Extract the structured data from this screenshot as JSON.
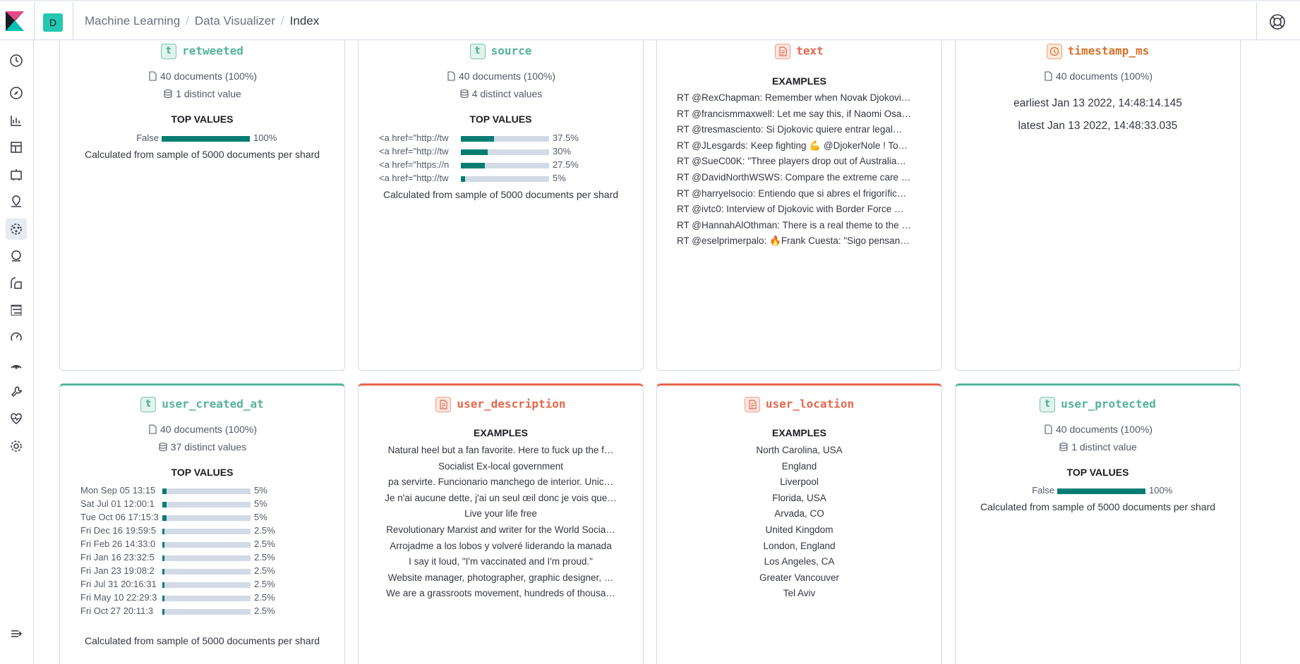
{
  "header": {
    "space_initial": "D",
    "breadcrumbs": [
      "Machine Learning",
      "Data Visualizer",
      "Index"
    ]
  },
  "sidebar": {
    "icons": [
      "clock-icon",
      "compass-icon",
      "chart-icon",
      "dashboard-icon",
      "canvas-icon",
      "maps-icon",
      "machine-learning-icon",
      "graph-icon",
      "observability-icon",
      "logs-icon",
      "apm-icon",
      "uptime-icon",
      "dev-tools-icon",
      "stack-monitoring-icon",
      "management-icon",
      "collapse-icon"
    ]
  },
  "colors": {
    "keyword": "#54b399",
    "text": "#e7664c",
    "date": "#d6712c",
    "bar_fill": "#017d73",
    "bar_track": "#d3dae6"
  },
  "cards": {
    "retweeted": {
      "name": "retweeted",
      "type_icon": "t",
      "documents": "40 documents (100%)",
      "distinct": "1 distinct value",
      "top_values_title": "TOP VALUES",
      "top_values": [
        {
          "label": "False",
          "pct_text": "100%",
          "pct": 100
        }
      ],
      "footer": "Calculated from sample of 5000 documents per shard"
    },
    "source": {
      "name": "source",
      "type_icon": "t",
      "documents": "40 documents (100%)",
      "distinct": "4 distinct values",
      "top_values_title": "TOP VALUES",
      "top_values": [
        {
          "label": "<a href=\"http://tw",
          "pct_text": "37.5%",
          "pct": 37.5
        },
        {
          "label": "<a href=\"http://tw",
          "pct_text": "30%",
          "pct": 30
        },
        {
          "label": "<a href=\"https://n",
          "pct_text": "27.5%",
          "pct": 27.5
        },
        {
          "label": "<a href=\"http://tw",
          "pct_text": "5%",
          "pct": 5
        }
      ],
      "footer": "Calculated from sample of 5000 documents per shard"
    },
    "text": {
      "name": "text",
      "examples_title": "EXAMPLES",
      "examples": [
        "RT @RexChapman: Remember when Novak Djokovi…",
        "RT @francismmaxwell: Let me say this, if Naomi Osa…",
        "RT @tresmasciento: Si Djokovic quiere entrar legal…",
        "RT @JLesgards: Keep fighting 💪 @DjokerNole ! To…",
        "RT @SueC00K: \"Three players drop out of Australia…",
        "RT @DavidNorthWSWS: Compare the extreme care …",
        "RT @harryelsocio: Entiendo que si abres el frigorífic…",
        "RT @ivtc0: Interview of Djokovic with Border Force …",
        "RT @HannahAlOthman: There is a real theme to the …",
        "RT @eselprimerpalo: 🔥Frank Cuesta: \"Sigo pensan…"
      ]
    },
    "timestamp_ms": {
      "name": "timestamp_ms",
      "documents": "40 documents (100%)",
      "earliest": "earliest Jan 13 2022, 14:48:14.145",
      "latest": "latest Jan 13 2022, 14:48:33.035"
    },
    "user_created_at": {
      "name": "user_created_at",
      "type_icon": "t",
      "documents": "40 documents (100%)",
      "distinct": "37 distinct values",
      "top_values_title": "TOP VALUES",
      "top_values": [
        {
          "label": "Mon Sep 05 13:15",
          "pct_text": "5%",
          "pct": 5
        },
        {
          "label": "Sat Jul 01 12:00:1",
          "pct_text": "5%",
          "pct": 5
        },
        {
          "label": "Tue Oct 06 17:15:3",
          "pct_text": "5%",
          "pct": 5
        },
        {
          "label": "Fri Dec 16 19:59:5",
          "pct_text": "2.5%",
          "pct": 2.5
        },
        {
          "label": "Fri Feb 26 14:33:0",
          "pct_text": "2.5%",
          "pct": 2.5
        },
        {
          "label": "Fri Jan 16 23:32:5",
          "pct_text": "2.5%",
          "pct": 2.5
        },
        {
          "label": "Fri Jan 23 19:08:2",
          "pct_text": "2.5%",
          "pct": 2.5
        },
        {
          "label": "Fri Jul 31 20:16:31",
          "pct_text": "2.5%",
          "pct": 2.5
        },
        {
          "label": "Fri May 10 22:29:3",
          "pct_text": "2.5%",
          "pct": 2.5
        },
        {
          "label": "Fri Oct 27 20:11:3",
          "pct_text": "2.5%",
          "pct": 2.5
        }
      ],
      "footer": "Calculated from sample of 5000 documents per shard"
    },
    "user_description": {
      "name": "user_description",
      "examples_title": "EXAMPLES",
      "examples": [
        "Natural heel but a fan favorite. Here to fuck up the f…",
        "Socialist Ex-local government",
        "pa servirte. Funcionario manchego de interior. Unic…",
        "Je n'ai aucune dette, j'ai un seul œil donc je vois que…",
        "Live your life free",
        "Revolutionary Marxist and writer for the World Socia…",
        "Arrojadme a los lobos y volveré liderando la manada",
        "I say it loud, \"I'm vaccinated and I'm proud.\"",
        "Website manager, photographer, graphic designer, …",
        "We are a grassroots movement, hundreds of thousa…"
      ]
    },
    "user_location": {
      "name": "user_location",
      "examples_title": "EXAMPLES",
      "examples": [
        "North Carolina, USA",
        "England",
        "Liverpool",
        "Florida, USA",
        "Arvada, CO",
        "United Kingdom",
        "London, England",
        "Los Angeles, CA",
        "Greater Vancouver",
        "Tel Aviv"
      ]
    },
    "user_protected": {
      "name": "user_protected",
      "type_icon": "t",
      "documents": "40 documents (100%)",
      "distinct": "1 distinct value",
      "top_values_title": "TOP VALUES",
      "top_values": [
        {
          "label": "False",
          "pct_text": "100%",
          "pct": 100
        }
      ],
      "footer": "Calculated from sample of 5000 documents per shard"
    }
  }
}
